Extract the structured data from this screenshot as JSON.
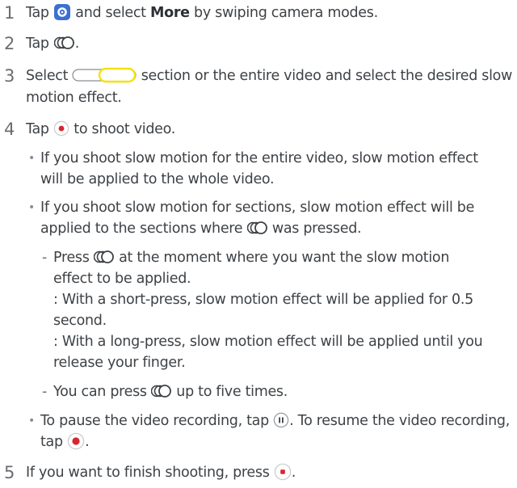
{
  "steps": [
    {
      "num": "1",
      "t1": "Tap",
      "t2": "and select",
      "bold": "More",
      "t3": "by swiping camera modes."
    },
    {
      "num": "2",
      "t1": "Tap",
      "t2": "."
    },
    {
      "num": "3",
      "t1": "Select",
      "t2": "section or the entire video and select the desired slow",
      "t3": "motion effect."
    },
    {
      "num": "4",
      "t1": "Tap",
      "t2": "to shoot video."
    },
    {
      "num": "5",
      "t1": "If you want to finish shooting, press",
      "t2": "."
    }
  ],
  "bullets": {
    "b1": {
      "l1": "If you shoot slow motion for the entire video, slow motion effect",
      "l2": "will be applied to the whole video."
    },
    "b2": {
      "l1": "If you shoot slow motion for sections, slow motion effect will be",
      "l2a": "applied to the sections where",
      "l2b": "was pressed."
    },
    "d1": {
      "a": "Press",
      "b": "at the moment where you want the slow motion",
      "l2": "effect to be applied.",
      "l3": ": With a short-press, slow motion effect will be applied for 0.5",
      "l4": "second.",
      "l5": ": With a long-press, slow motion effect will be applied until you",
      "l6": "release your finger."
    },
    "d2": {
      "a": "You can press",
      "b": "up to five times."
    },
    "b3": {
      "a": "To pause the video recording, tap",
      "b": ". To resume the video recording,",
      "l2a": "tap",
      "l2b": "."
    }
  },
  "symbols": {
    "bullet": "•",
    "dash": "-"
  },
  "icons": [
    "camera-mode-icon",
    "slow-motion-icon",
    "section-slider-icon",
    "record-icon",
    "pause-icon",
    "stop-icon"
  ],
  "colors": {
    "text": "#3e4246",
    "accent_yellow": "#f5e10f",
    "record_red": "#d8262f",
    "camera_blue": "#3d6fd1"
  }
}
